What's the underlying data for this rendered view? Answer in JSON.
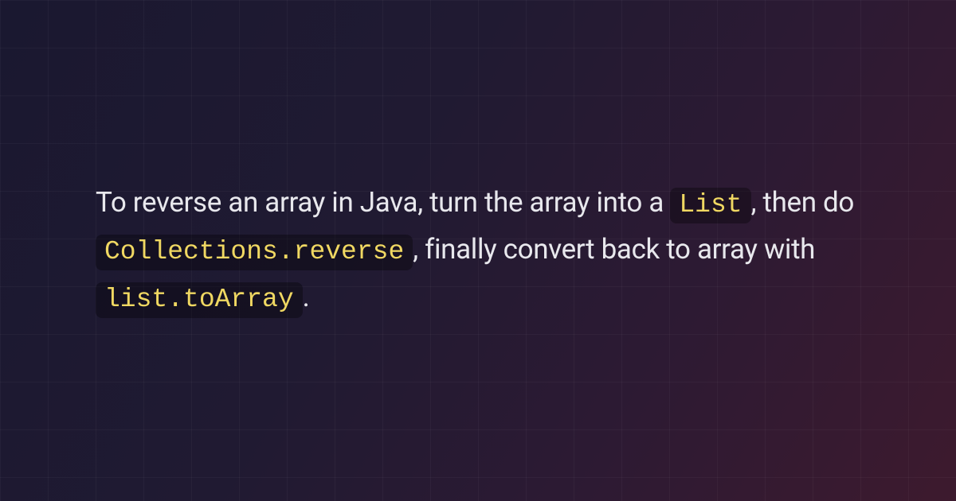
{
  "paragraph": {
    "seg1": "To reverse an array in Java, turn the array into a ",
    "code1": "List",
    "seg2": ", then do ",
    "code2": "Collections.reverse",
    "seg3": ", finally convert back to array with ",
    "code3": "list.toArray",
    "seg4": "."
  }
}
